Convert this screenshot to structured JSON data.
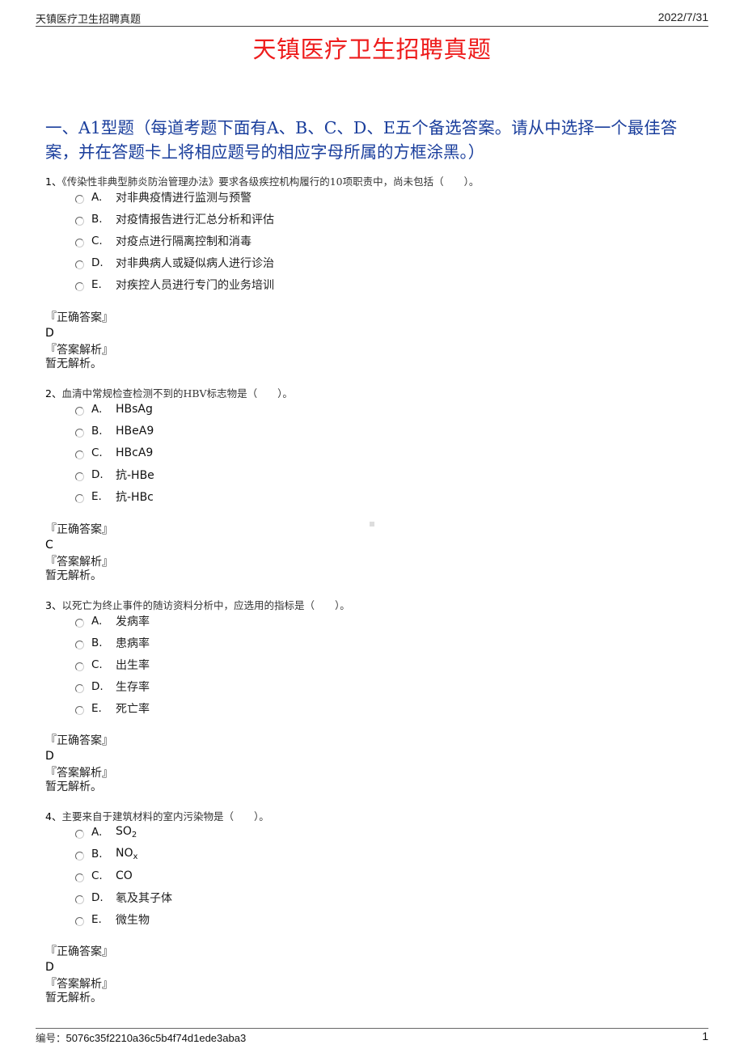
{
  "header": {
    "doc_name": "天镇医疗卫生招聘真题",
    "date": "2022/7/31"
  },
  "title": "天镇医疗卫生招聘真题",
  "section_heading": "一、A1型题（每道考题下面有A、B、C、D、E五个备选答案。请从中选择一个最佳答案，并在答题卡上将相应题号的相应字母所属的方框涂黑。）",
  "labels": {
    "correct_answer": "『正确答案』",
    "analysis": "『答案解析』"
  },
  "questions": [
    {
      "number": "1、",
      "text": "《传染性非典型肺炎防治管理办法》要求各级疾控机构履行的10项职责中，尚未包括（　　）。",
      "options": [
        {
          "letter": "A.",
          "text": "对非典疫情进行监测与预警"
        },
        {
          "letter": "B.",
          "text": "对疫情报告进行汇总分析和评估"
        },
        {
          "letter": "C.",
          "text": "对疫点进行隔离控制和消毒"
        },
        {
          "letter": "D.",
          "text": "对非典病人或疑似病人进行诊治"
        },
        {
          "letter": "E.",
          "text": "对疾控人员进行专门的业务培训"
        }
      ],
      "answer": "D",
      "analysis": "暂无解析。"
    },
    {
      "number": "2、",
      "text": "血清中常规检查检测不到的HBV标志物是（　　）。",
      "options": [
        {
          "letter": "A.",
          "text": "HBsAg"
        },
        {
          "letter": "B.",
          "text": "HBeA9"
        },
        {
          "letter": "C.",
          "text": "HBcA9"
        },
        {
          "letter": "D.",
          "text": "抗-HBe"
        },
        {
          "letter": "E.",
          "text": "抗-HBc"
        }
      ],
      "answer": "C",
      "analysis": "暂无解析。"
    },
    {
      "number": "3、",
      "text": "以死亡为终止事件的随访资料分析中，应选用的指标是（　　）。",
      "options": [
        {
          "letter": "A.",
          "text": "发病率"
        },
        {
          "letter": "B.",
          "text": "患病率"
        },
        {
          "letter": "C.",
          "text": "出生率"
        },
        {
          "letter": "D.",
          "text": "生存率"
        },
        {
          "letter": "E.",
          "text": "死亡率"
        }
      ],
      "answer": "D",
      "analysis": "暂无解析。"
    },
    {
      "number": "4、",
      "text": "主要来自于建筑材料的室内污染物是（　　）。",
      "options": [
        {
          "letter": "A.",
          "text": "SO",
          "sub": "2"
        },
        {
          "letter": "B.",
          "text": "NO",
          "sub": "x"
        },
        {
          "letter": "C.",
          "text": "CO"
        },
        {
          "letter": "D.",
          "text": "氡及其子体"
        },
        {
          "letter": "E.",
          "text": "微生物"
        }
      ],
      "answer": "D",
      "analysis": "暂无解析。"
    }
  ],
  "footer": {
    "id_label": "编号：",
    "id_value": "5076c35f2210a36c5b4f74d1ede3aba3",
    "page_number": "1"
  }
}
